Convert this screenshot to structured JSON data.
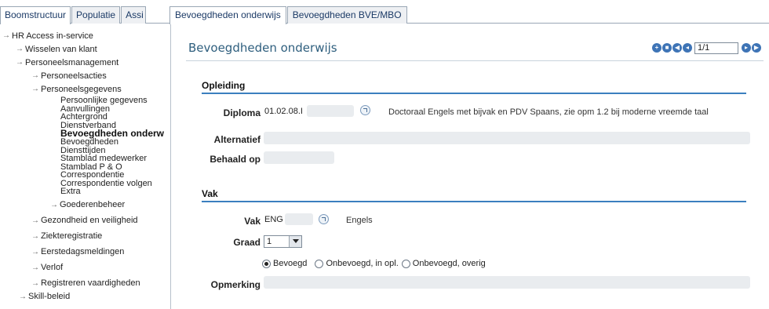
{
  "left_tabs": [
    "Boomstructuur",
    "Populatie",
    "Assi"
  ],
  "right_tabs": [
    "Bevoegdheden onderwijs",
    "Bevoegdheden BVE/MBO"
  ],
  "tree": {
    "root": "HR Access in-service",
    "wisselen": "Wisselen van klant",
    "personeelsmanagement": "Personeelsmanagement",
    "personeelsacties": "Personeelsacties",
    "personeelsgegevens": "Personeelsgegevens",
    "leaves": [
      "Persoonlijke gegevens",
      "Aanvullingen",
      "Achtergrond",
      "Dienstverband",
      "Bevoegdheden onderw",
      "Bevoegdheden",
      "Diensttijden",
      "Stamblad medewerker",
      "Stamblad P & O",
      "Correspondentie",
      "Correspondentie volgen",
      "Extra"
    ],
    "goederenbeheer": "Goederenbeheer",
    "gezondheid": "Gezondheid en veiligheid",
    "ziekteregistratie": "Ziekteregistratie",
    "eerstedagsmeldingen": "Eerstedagsmeldingen",
    "verlof": "Verlof",
    "vaardigheden": "Registreren vaardigheden",
    "skill": "Skill-beleid"
  },
  "page": {
    "title": "Bevoegdheden onderwijs",
    "record": "1/1",
    "nav_icons": [
      "add-icon",
      "save-icon",
      "first-icon",
      "prev-icon",
      "next-icon",
      "last-icon"
    ]
  },
  "opleiding": {
    "heading": "Opleiding",
    "diploma_label": "Diploma",
    "diploma_code": "01.02.08.I",
    "diploma_desc": "Doctoraal Engels met bijvak en PDV Spaans, zie opm 1.2 bij moderne vreemde taal",
    "alternatief_label": "Alternatief",
    "behaald_label": "Behaald op"
  },
  "vak": {
    "heading": "Vak",
    "vak_label": "Vak",
    "vak_code": "ENG",
    "vak_desc": "Engels",
    "graad_label": "Graad",
    "graad_value": "1",
    "radio_options": [
      "Bevoegd",
      "Onbevoegd, in opl.",
      "Onbevoegd, overig"
    ],
    "radio_selected": 0,
    "opmerking_label": "Opmerking"
  },
  "colors": {
    "accent": "#3b7fbf",
    "title": "#2f5f7e",
    "tab_text": "#1b3a66"
  }
}
